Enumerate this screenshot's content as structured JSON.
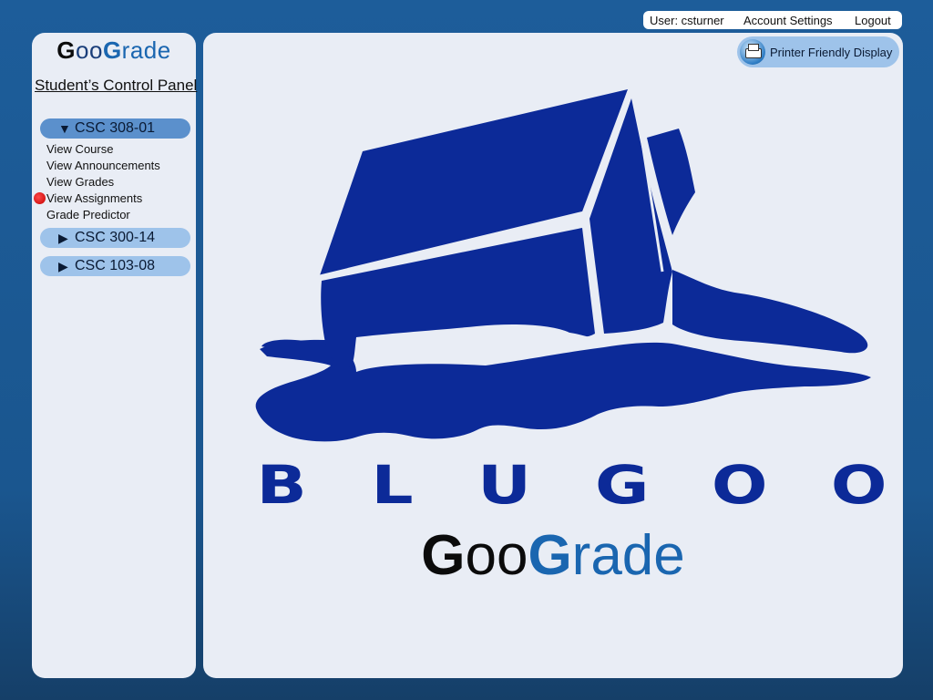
{
  "topbar": {
    "user": "User:  csturner",
    "account_settings": "Account Settings",
    "logout": "Logout"
  },
  "brand": {
    "g1": "G",
    "oo": "oo",
    "g2": "G",
    "rade": "rade"
  },
  "sidebar": {
    "panel_title": "Student’s Control Panel",
    "courses": [
      {
        "arrow": "▼",
        "label": "CSC 308-01",
        "expanded": true,
        "links": [
          {
            "label": "View Course",
            "active": false
          },
          {
            "label": "View Announcements",
            "active": false
          },
          {
            "label": "View Grades",
            "active": false
          },
          {
            "label": "View Assignments",
            "active": true
          },
          {
            "label": "Grade Predictor",
            "active": false
          }
        ]
      },
      {
        "arrow": "▶",
        "label": "CSC 300-14",
        "expanded": false
      },
      {
        "arrow": "▶",
        "label": "CSC 103-08",
        "expanded": false
      }
    ]
  },
  "main": {
    "printer_button": "Printer Friendly Display",
    "logo_letters": [
      "B",
      "L",
      "U",
      "G",
      "O",
      "O"
    ]
  },
  "colors": {
    "background": "#1a568f",
    "panel": "#e9edf5",
    "logo_blue": "#0c2a98",
    "brand_blue": "#1a66b0",
    "course_open": "#5b90cc",
    "course_closed": "#9ec3ea",
    "active_marker": "#d40000"
  },
  "icons": {
    "printer": "printer-icon",
    "active_marker": "red-dot-icon",
    "expand": "triangle-down-icon",
    "collapse": "triangle-right-icon"
  }
}
